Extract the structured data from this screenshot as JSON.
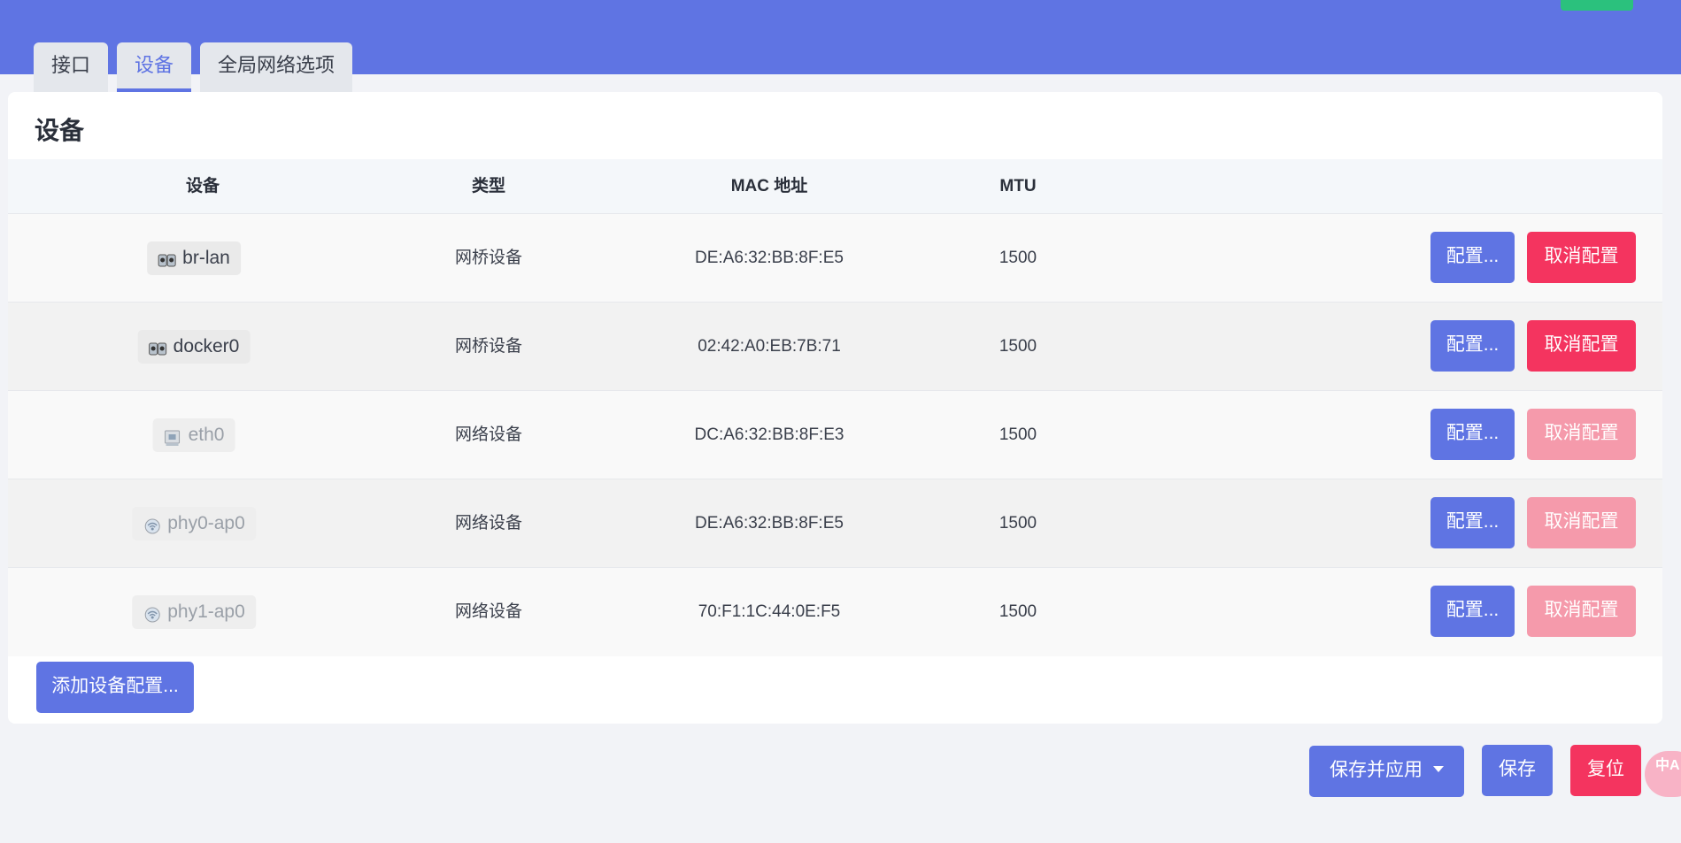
{
  "tabs": [
    {
      "label": "接口",
      "active": false
    },
    {
      "label": "设备",
      "active": true
    },
    {
      "label": "全局网络选项",
      "active": false
    }
  ],
  "panel": {
    "title": "设备",
    "columns": [
      "设备",
      "类型",
      "MAC 地址",
      "MTU"
    ],
    "rows": [
      {
        "device": "br-lan",
        "icon": "bridge-icon",
        "type": "网桥设备",
        "mac": "DE:A6:32:BB:8F:E5",
        "mtu": "1500",
        "configure": "配置...",
        "unconfigure": "取消配置",
        "unconfigure_enabled": true
      },
      {
        "device": "docker0",
        "icon": "bridge-icon",
        "type": "网桥设备",
        "mac": "02:42:A0:EB:7B:71",
        "mtu": "1500",
        "configure": "配置...",
        "unconfigure": "取消配置",
        "unconfigure_enabled": true
      },
      {
        "device": "eth0",
        "icon": "ethernet-icon",
        "type": "网络设备",
        "mac": "DC:A6:32:BB:8F:E3",
        "mtu": "1500",
        "configure": "配置...",
        "unconfigure": "取消配置",
        "unconfigure_enabled": false
      },
      {
        "device": "phy0-ap0",
        "icon": "wifi-icon",
        "type": "网络设备",
        "mac": "DE:A6:32:BB:8F:E5",
        "mtu": "1500",
        "configure": "配置...",
        "unconfigure": "取消配置",
        "unconfigure_enabled": false
      },
      {
        "device": "phy1-ap0",
        "icon": "wifi-icon",
        "type": "网络设备",
        "mac": "70:F1:1C:44:0E:F5",
        "mtu": "1500",
        "configure": "配置...",
        "unconfigure": "取消配置",
        "unconfigure_enabled": false
      }
    ],
    "add_button": "添加设备配置..."
  },
  "actions": {
    "save_apply": "保存并应用",
    "save": "保存",
    "reset": "复位"
  },
  "translate_badge": "中A",
  "colors": {
    "header": "#5f74e3",
    "primary": "#5f74e3",
    "danger": "#f4345f",
    "danger_disabled": "#f59aab"
  }
}
